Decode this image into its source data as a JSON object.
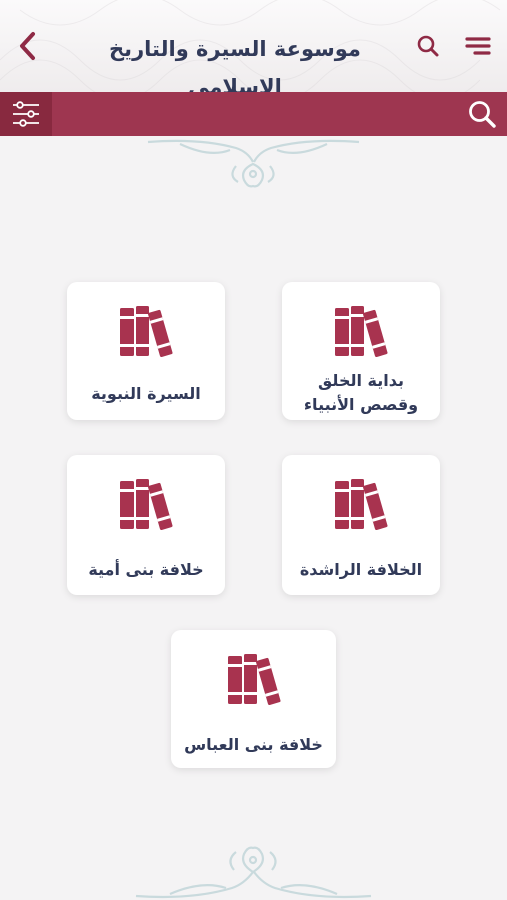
{
  "header": {
    "title": "موسوعة السيرة والتاريخ الإسلامي",
    "back_icon": "chevron-left-icon",
    "search_icon": "search-icon",
    "menu_icon": "menu-icon"
  },
  "search_bar": {
    "placeholder": "",
    "filter_icon": "sliders-icon",
    "search_icon": "search-icon"
  },
  "categories": [
    {
      "line1": "بداية الخلق",
      "line2": "وقصص الأنبياء",
      "icon": "books-icon"
    },
    {
      "line1": "السيرة النبوية",
      "line2": "",
      "icon": "books-icon"
    },
    {
      "line1": "الخلافة الراشدة",
      "line2": "",
      "icon": "books-icon"
    },
    {
      "line1": "خلافة بنى أمية",
      "line2": "",
      "icon": "books-icon"
    },
    {
      "line1": "خلافة بنى العباس",
      "line2": "",
      "icon": "books-icon"
    }
  ],
  "colors": {
    "accent": "#9e3650",
    "accent_dark": "#88293f",
    "text": "#313a59",
    "ornament": "#cfdde0",
    "background": "#f4f3f4"
  }
}
